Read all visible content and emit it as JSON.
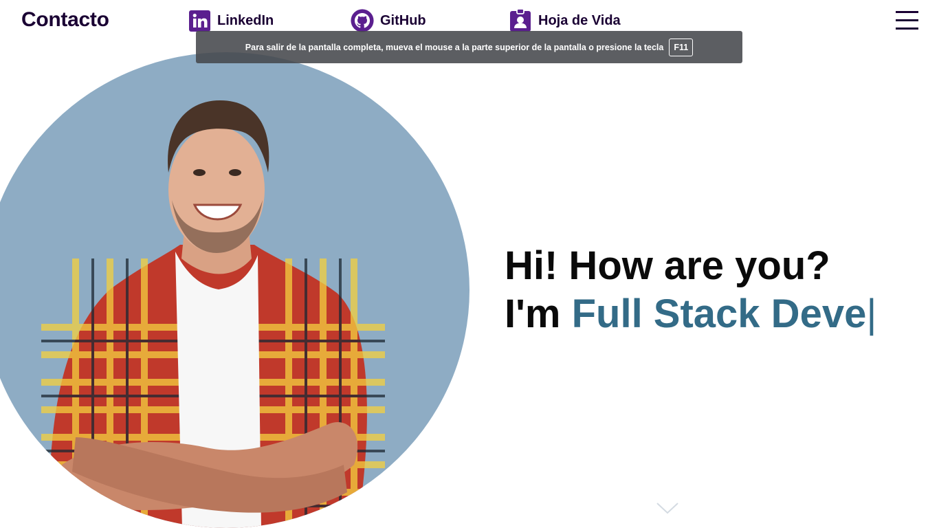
{
  "header": {
    "brand": "Contacto",
    "links": [
      {
        "label": "LinkedIn",
        "icon": "linkedin-icon"
      },
      {
        "label": "GitHub",
        "icon": "github-icon"
      },
      {
        "label": "Hoja de Vida",
        "icon": "id-badge-icon"
      }
    ],
    "menu_icon": "hamburger-menu-icon"
  },
  "fullscreen_notice": {
    "message": "Para salir de la pantalla completa, mueva el mouse a la parte superior de la pantalla o presione la tecla",
    "key": "F11"
  },
  "hero": {
    "greeting": "Hi! How are you?",
    "intro_prefix": "I'm ",
    "typed_role": "Full Stack Deve",
    "caret": "|",
    "scroll_icon": "chevron-down-icon"
  },
  "colors": {
    "brand_dark": "#1a0033",
    "icon_purple": "#5b1f8f",
    "accent_role": "#336b87",
    "circle_bg": "#8eacc4"
  }
}
